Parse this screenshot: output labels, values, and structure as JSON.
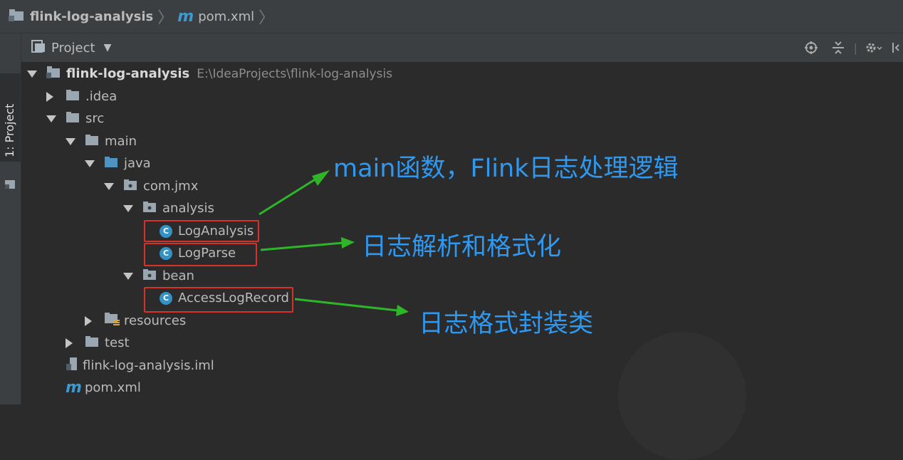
{
  "breadcrumb": {
    "project": "flink-log-analysis",
    "file_icon": "m",
    "file": "pom.xml"
  },
  "side_tab": {
    "label": "1: Project"
  },
  "panel": {
    "title": "Project",
    "tools": [
      "locate-icon",
      "collapse-icon",
      "gear-icon",
      "hide-icon"
    ]
  },
  "tree": {
    "root_name": "flink-log-analysis",
    "root_path": "E:\\IdeaProjects\\flink-log-analysis",
    "idea": ".idea",
    "src": "src",
    "main": "main",
    "java": "java",
    "pkg": "com.jmx",
    "analysis": "analysis",
    "log_analysis": "LogAnalysis",
    "log_parse": "LogParse",
    "bean": "bean",
    "access_log_record": "AccessLogRecord",
    "resources": "resources",
    "test": "test",
    "iml": "flink-log-analysis.iml",
    "pom_icon": "m",
    "pom": "pom.xml",
    "class_glyph": "C"
  },
  "annotations": {
    "main": "main函数，Flink日志处理逻辑",
    "parse": "日志解析和格式化",
    "bean": "日志格式封装类"
  },
  "colors": {
    "annotation": "#2f98f0",
    "arrow": "#2fb52a",
    "highlight_box": "#d8312a",
    "class_icon": "#3592c4"
  }
}
